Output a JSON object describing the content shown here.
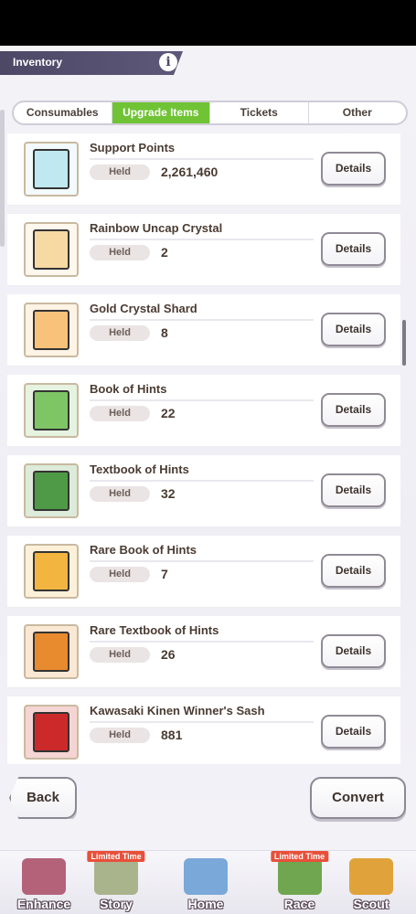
{
  "header": {
    "title": "Inventory",
    "info_icon": "info-icon"
  },
  "tabs": [
    {
      "label": "Consumables",
      "active": false
    },
    {
      "label": "Upgrade Items",
      "active": true
    },
    {
      "label": "Tickets",
      "active": false
    },
    {
      "label": "Other",
      "active": false
    }
  ],
  "held_label": "Held",
  "details_label": "Details",
  "items": [
    {
      "name": "Support Points",
      "held": "2,261,460",
      "icon": "support-points-icon",
      "color": "#bfe8f0"
    },
    {
      "name": "Rainbow Uncap Crystal",
      "held": "2",
      "icon": "rainbow-crystal-icon",
      "color": "#f7d9a4"
    },
    {
      "name": "Gold Crystal Shard",
      "held": "8",
      "icon": "gold-shard-icon",
      "color": "#f8c27a"
    },
    {
      "name": "Book of Hints",
      "held": "22",
      "icon": "book-of-hints-icon",
      "color": "#7ec566"
    },
    {
      "name": "Textbook of Hints",
      "held": "32",
      "icon": "textbook-of-hints-icon",
      "color": "#4f9a46"
    },
    {
      "name": "Rare Book of Hints",
      "held": "7",
      "icon": "rare-book-of-hints-icon",
      "color": "#f2b540"
    },
    {
      "name": "Rare Textbook of Hints",
      "held": "26",
      "icon": "rare-textbook-of-hints-icon",
      "color": "#e88a2e"
    },
    {
      "name": "Kawasaki Kinen Winner's Sash",
      "held": "881",
      "icon": "winners-sash-icon",
      "color": "#cc2a2a"
    }
  ],
  "buttons": {
    "back": "Back",
    "convert": "Convert"
  },
  "nav": [
    {
      "label": "Enhance",
      "badge": "",
      "icon": "enhance-icon",
      "color": "#b3627a"
    },
    {
      "label": "Story",
      "badge": "Limited Time",
      "icon": "story-icon",
      "color": "#a9b38c"
    },
    {
      "label": "Home",
      "badge": "",
      "icon": "home-icon",
      "color": "#7aa8d8"
    },
    {
      "label": "Race",
      "badge": "Limited Time",
      "icon": "race-icon",
      "color": "#6fa64f"
    },
    {
      "label": "Scout",
      "badge": "",
      "icon": "scout-icon",
      "color": "#e0a33b"
    }
  ]
}
